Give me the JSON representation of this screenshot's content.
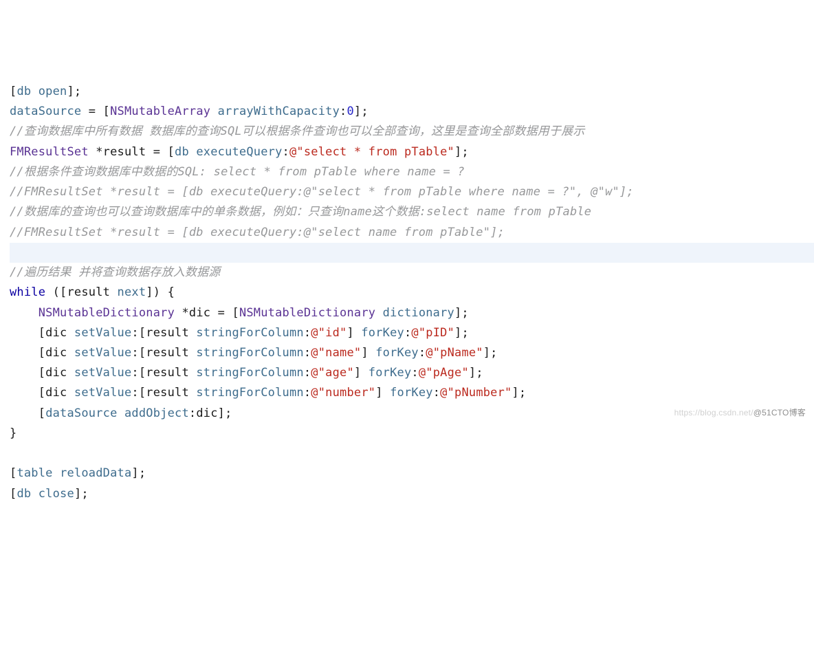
{
  "code": {
    "l1": {
      "a": "[",
      "b": "db",
      "c": " ",
      "d": "open",
      "e": "];"
    },
    "l2": {
      "a": "dataSource",
      "b": " = [",
      "c": "NSMutableArray",
      "d": " ",
      "e": "arrayWithCapacity",
      "f": ":",
      "g": "0",
      "h": "];"
    },
    "l3": "//查询数据库中所有数据 数据库的查询SQL可以根据条件查询也可以全部查询，这里是查询全部数据用于展示",
    "l4": {
      "a": "FMResultSet",
      "b": " *result = [",
      "c": "db",
      "d": " ",
      "e": "executeQuery",
      "f": ":",
      "g": "@",
      "h": "\"select * from pTable\"",
      "i": "];"
    },
    "l5": "//根据条件查询数据库中数据的SQL: select * from pTable where name = ?",
    "l6": "//FMResultSet *result = [db executeQuery:@\"select * from pTable where name = ?\", @\"w\"];",
    "l7": "//数据库的查询也可以查询数据库中的单条数据，例如：只查询name这个数据:select name from pTable",
    "l8": "//FMResultSet *result = [db executeQuery:@\"select name from pTable\"];",
    "l9": " ",
    "l10": "//遍历结果 并将查询数据存放入数据源",
    "l11": {
      "a": "while",
      "b": " ([result ",
      "c": "next",
      "d": "]) {"
    },
    "l12": {
      "a": "    ",
      "b": "NSMutableDictionary",
      "c": " *dic = [",
      "d": "NSMutableDictionary",
      "e": " ",
      "f": "dictionary",
      "g": "];"
    },
    "l13": {
      "a": "    [dic ",
      "b": "setValue",
      "c": ":[result ",
      "d": "stringForColumn",
      "e": ":",
      "f": "@",
      "g": "\"id\"",
      "h": "] ",
      "i": "forKey",
      "j": ":",
      "k": "@",
      "l": "\"pID\"",
      "m": "];"
    },
    "l14": {
      "a": "    [dic ",
      "b": "setValue",
      "c": ":[result ",
      "d": "stringForColumn",
      "e": ":",
      "f": "@",
      "g": "\"name\"",
      "h": "] ",
      "i": "forKey",
      "j": ":",
      "k": "@",
      "l": "\"pName\"",
      "m": "];"
    },
    "l15": {
      "a": "    [dic ",
      "b": "setValue",
      "c": ":[result ",
      "d": "stringForColumn",
      "e": ":",
      "f": "@",
      "g": "\"age\"",
      "h": "] ",
      "i": "forKey",
      "j": ":",
      "k": "@",
      "l": "\"pAge\"",
      "m": "];"
    },
    "l16": {
      "a": "    [dic ",
      "b": "setValue",
      "c": ":[result ",
      "d": "stringForColumn",
      "e": ":",
      "f": "@",
      "g": "\"number\"",
      "h": "] ",
      "i": "forKey",
      "j": ":",
      "k": "@",
      "l": "\"pNumber\"",
      "m": "];"
    },
    "l17": {
      "a": "    [",
      "b": "dataSource",
      "c": " ",
      "d": "addObject",
      "e": ":dic];"
    },
    "l18": "}",
    "l19": " ",
    "l20": {
      "a": "[",
      "b": "table",
      "c": " ",
      "d": "reloadData",
      "e": "];"
    },
    "l21": {
      "a": "[",
      "b": "db",
      "c": " ",
      "d": "close",
      "e": "];"
    }
  },
  "watermark": {
    "left": "https://blog.csdn.net/",
    "right": "@51CTO博客"
  }
}
